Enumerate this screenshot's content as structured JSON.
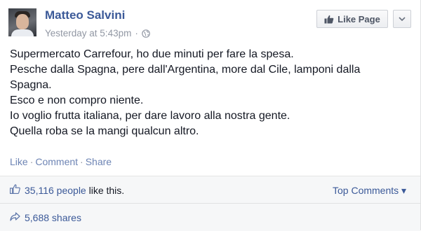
{
  "post": {
    "author": "Matteo Salvini",
    "timestamp": "Yesterday at 5:43pm",
    "separator": "·",
    "audience_icon": "globe-icon",
    "like_page_label": "Like Page",
    "menu_icon": "chevron-down-icon",
    "lines": [
      "Supermercato Carrefour, ho due minuti per fare la spesa.",
      "Pesche dalla Spagna, pere dall'Argentina, more dal Cile, lamponi dalla",
      "Spagna.",
      "Esco e non compro niente.",
      "Io voglio frutta italiana, per dare lavoro alla nostra gente.",
      "Quella roba se la mangi qualcun altro."
    ]
  },
  "actions": {
    "like": "Like",
    "comment": "Comment",
    "share": "Share",
    "separator": "·"
  },
  "footer": {
    "likes_count": "35,116 people",
    "likes_suffix": " like this.",
    "top_comments": "Top Comments",
    "top_comments_caret": "▾",
    "shares": "5,688 shares"
  },
  "colors": {
    "link": "#3b5998",
    "muted": "#9197a3",
    "text": "#141823",
    "footer_bg": "#f6f7f8"
  }
}
